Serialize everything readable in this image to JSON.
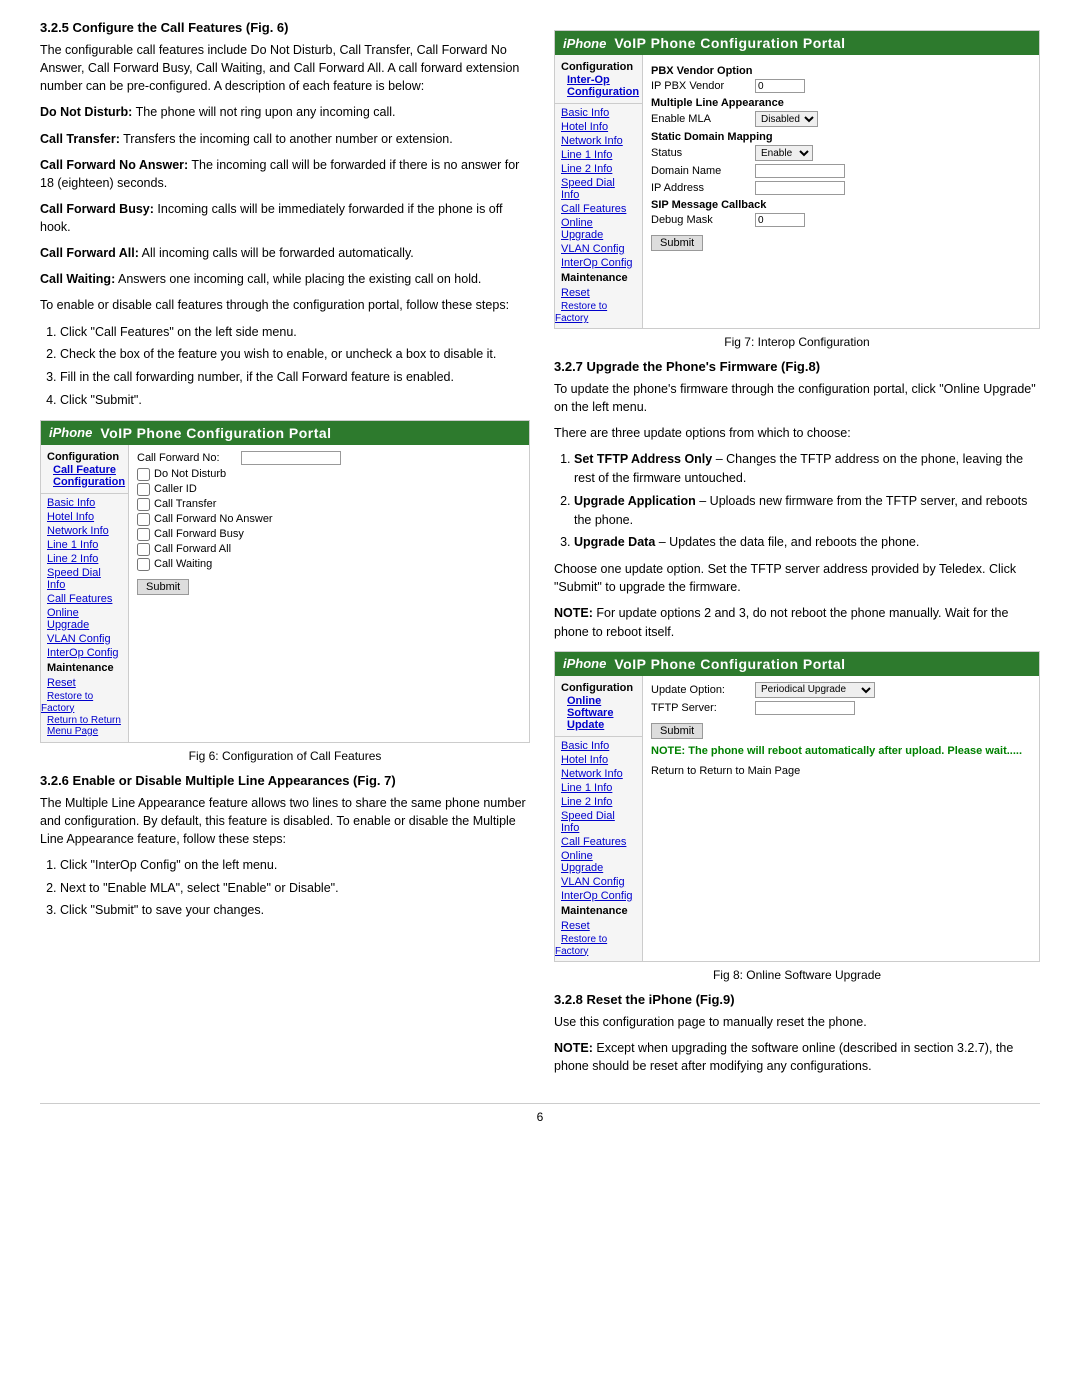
{
  "page": {
    "number": "6"
  },
  "left_col": {
    "section_325": {
      "heading": "3.2.5 Configure the Call Features (Fig. 6)",
      "intro": "The configurable call features include Do Not Disturb, Call Transfer, Call Forward No Answer, Call Forward Busy, Call Waiting, and Call Forward All. A call forward extension number can be pre-configured. A description of each feature is below:",
      "features": [
        {
          "name": "Do Not Disturb:",
          "desc": " The phone will not ring upon any incoming call."
        },
        {
          "name": "Call Transfer:",
          "desc": " Transfers the incoming call to another number or extension."
        },
        {
          "name": "Call Forward No Answer:",
          "desc": " The incoming call will be forwarded if there is no answer for 18 (eighteen) seconds."
        },
        {
          "name": "Call Forward Busy:",
          "desc": " Incoming calls will be immediately forwarded if the phone is off hook."
        },
        {
          "name": "Call Forward All:",
          "desc": " All incoming calls will be forwarded automatically."
        },
        {
          "name": "Call Waiting:",
          "desc": " Answers one incoming call, while placing the existing call on hold."
        }
      ],
      "steps_intro": "To enable or disable call features through the configuration portal, follow these steps:",
      "steps": [
        "Click \"Call Features\" on the left side menu.",
        "Check the box of the feature you wish to enable, or uncheck a box to disable it.",
        "Fill in the call forwarding number, if the Call Forward feature is enabled.",
        "Click \"Submit\"."
      ]
    },
    "fig6_caption": "Fig 6: Configuration of Call Features",
    "section_326": {
      "heading": "3.2.6 Enable or Disable Multiple Line Appearances (Fig. 7)",
      "intro": "The Multiple Line Appearance feature allows two lines to share the same phone number and configuration. By default, this feature is disabled. To enable or disable the Multiple Line Appearance feature, follow these steps:",
      "steps": [
        "Click \"InterOp Config\" on the left menu.",
        "Next to \"Enable MLA\", select \"Enable\" or Disable\".",
        "Click \"Submit\" to save your changes."
      ]
    }
  },
  "right_col": {
    "fig7_caption": "Fig 7: Interop Configuration",
    "section_327": {
      "heading": "3.2.7 Upgrade the Phone's Firmware (Fig.8)",
      "intro": "To update the phone's firmware through the configuration portal, click \"Online Upgrade\" on the left menu.",
      "options_intro": "There are three update options from which to choose:",
      "options": [
        {
          "name": "Set TFTP Address Only",
          "desc": " – Changes the TFTP address on the phone, leaving the rest of the firmware untouched."
        },
        {
          "name": "Upgrade Application",
          "desc": " – Uploads new firmware from the TFTP server, and reboots the phone."
        },
        {
          "name": "Upgrade Data",
          "desc": " – Updates the data file, and reboots the phone."
        }
      ],
      "note1": "Choose one update option. Set the TFTP server address provided by Teledex. Click \"Submit\" to upgrade the firmware.",
      "note2": "NOTE: For update options 2 and 3, do not reboot the phone manually. Wait for the phone to reboot itself."
    },
    "fig8_caption": "Fig 8: Online Software Upgrade",
    "section_328": {
      "heading": "3.2.8 Reset the iPhone (Fig.9)",
      "intro": "Use this configuration page to manually reset the phone.",
      "note": "NOTE: Except when upgrading the software online (described in section 3.2.7), the phone should be reset after modifying any configurations."
    }
  },
  "portal_fig6": {
    "header_title": "VoIP Phone Configuration Portal",
    "logo": "iPhone",
    "config_label": "Configuration",
    "config_link": "Call Feature Configuration",
    "nav_items": [
      "Basic Info",
      "Hotel Info",
      "Network Info",
      "Line 1 Info",
      "Line 2 Info",
      "Speed Dial Info",
      "Call Features",
      "Online Upgrade",
      "VLAN Config",
      "InterOp Config"
    ],
    "nav_maintenance": "Maintenance",
    "nav_reset": "Reset",
    "nav_restore": "Restore to Factory",
    "nav_return": "Return to Return Menu Page",
    "call_forward_no_label": "Call Forward No:",
    "checkboxes": [
      "Do Not Disturb",
      "Caller ID",
      "Call Transfer",
      "Call Forward No Answer",
      "Call Forward Busy",
      "Call Forward All",
      "Call Waiting"
    ],
    "submit_label": "Submit"
  },
  "portal_fig7": {
    "header_title": "VoIP Phone Configuration Portal",
    "logo": "iPhone",
    "config_label": "Configuration",
    "config_link": "Inter-Op Configuration",
    "nav_items": [
      "Basic Info",
      "Hotel Info",
      "Network Info",
      "Line 1 Info",
      "Line 2 Info",
      "Speed Dial Info",
      "Call Features",
      "Online Upgrade",
      "VLAN Config",
      "InterOp Config"
    ],
    "nav_maintenance": "Maintenance",
    "nav_reset": "Reset",
    "nav_restore": "Restore to Factory",
    "pbx_vendor_option": "PBX Vendor Option",
    "ip_pbx_vendor_label": "IP PBX Vendor",
    "ip_pbx_vendor_value": "0",
    "mla_label": "Multiple Line Appearance",
    "enable_mla_label": "Enable MLA",
    "enable_mla_value": "Disabled",
    "static_domain_label": "Static Domain Mapping",
    "status_label": "Status",
    "status_value": "Enable",
    "domain_name_label": "Domain Name",
    "ip_address_label": "IP Address",
    "sip_message_label": "SIP Message Callback",
    "debug_mask_label": "Debug Mask",
    "debug_mask_value": "0",
    "submit_label": "Submit"
  },
  "portal_fig8": {
    "header_title": "VoIP Phone Configuration Portal",
    "logo": "iPhone",
    "config_label": "Configuration",
    "config_link": "Online Software Update",
    "nav_items": [
      "Basic Info",
      "Hotel Info",
      "Network Info",
      "Line 1 Info",
      "Line 2 Info",
      "Speed Dial Info",
      "Call Features",
      "Online Upgrade",
      "VLAN Config",
      "InterOp Config"
    ],
    "nav_maintenance": "Maintenance",
    "nav_reset": "Reset",
    "nav_restore": "Restore to Factory",
    "update_option_label": "Update Option:",
    "update_option_value": "Periodical Upgrade",
    "tftp_server_label": "TFTP Server:",
    "submit_label": "Submit",
    "note_text": "NOTE: The phone will reboot automatically after upload. Please wait.....",
    "return_link": "Return to Main Page"
  }
}
